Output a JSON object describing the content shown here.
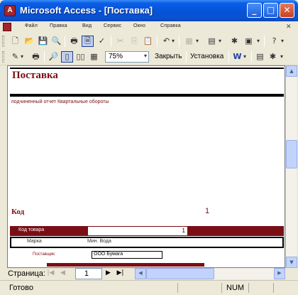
{
  "window": {
    "title": "Microsoft Access - [Поставка]",
    "app_icon": "access-key-icon",
    "minimize_glyph": "_",
    "maximize_glyph": "□",
    "close_glyph": "✕"
  },
  "menubar": {
    "items": [
      "Файл",
      "Правка",
      "Вид",
      "Сервис",
      "Окно",
      "Справка"
    ],
    "close_glyph": "✕"
  },
  "toolbar1": {
    "icons": [
      "new-icon",
      "open-icon",
      "save-icon",
      "search-file-icon",
      "print-icon",
      "print-preview-icon",
      "spelling-icon",
      "cut-icon",
      "copy-icon",
      "paste-icon",
      "undo-icon",
      "office-links-icon",
      "analyze-icon",
      "new-object-icon",
      "help-icon"
    ],
    "undo_arrow": "↶",
    "dropdown_glyph": "▾"
  },
  "toolbar2": {
    "zoom": "75%",
    "close_label": "Закрыть",
    "setup_label": "Установка",
    "icons": [
      "view-icon",
      "print-icon",
      "zoom-icon",
      "one-page-icon",
      "two-pages-icon",
      "multiple-pages-icon",
      "word-icon",
      "database-window-icon",
      "new-object-icon",
      "help-icon"
    ]
  },
  "report": {
    "title": "Поставка",
    "subline": "подчиненный отчет Квартальные обороты",
    "kod_label": "Код",
    "kod_value": "1",
    "band_label": "Код товара",
    "band_value": "1",
    "col1": "Марка",
    "col2": "Мин. Вода",
    "supplier_label": "Поставщик:",
    "supplier_value": "ООО Бумага"
  },
  "scrollbar": {
    "up": "▲",
    "down": "▼",
    "left": "◀",
    "right": "▶"
  },
  "navigation": {
    "label": "Страница:",
    "page": "1",
    "first": "|◀",
    "prev": "◀",
    "next": "▶",
    "last": "▶|"
  },
  "status": {
    "text": "Готово",
    "num": "NUM"
  }
}
